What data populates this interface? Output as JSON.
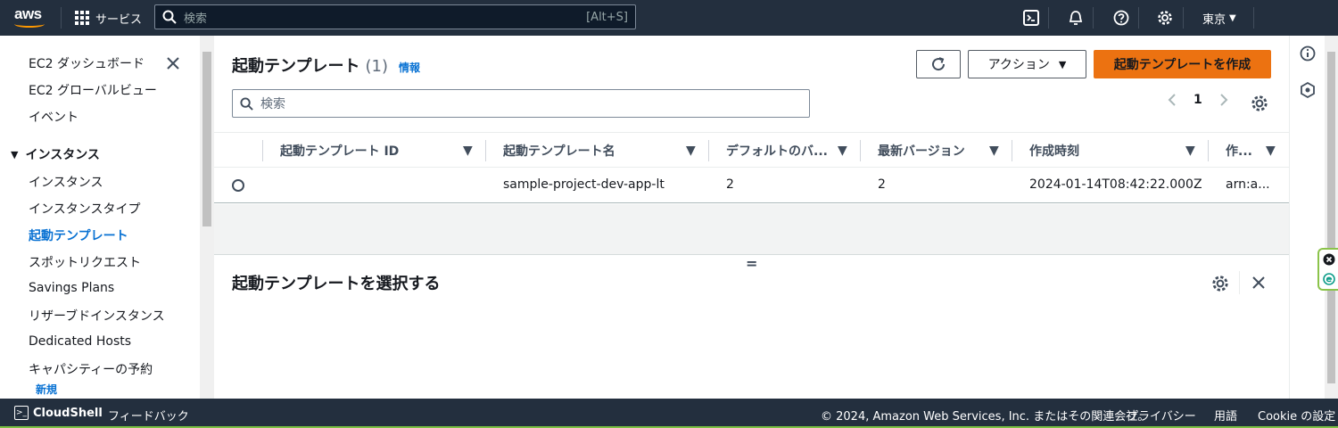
{
  "topnav": {
    "logo_text": "aws",
    "services_label": "サービス",
    "search_placeholder": "検索",
    "search_shortcut": "[Alt+S]",
    "region": "東京"
  },
  "sidebar": {
    "items": [
      {
        "label": "EC2 ダッシュボード"
      },
      {
        "label": "EC2 グローバルビュー"
      },
      {
        "label": "イベント"
      }
    ],
    "section_title": "インスタンス",
    "section_items": [
      {
        "label": "インスタンス"
      },
      {
        "label": "インスタンスタイプ"
      },
      {
        "label": "起動テンプレート",
        "active": true
      },
      {
        "label": "スポットリクエスト"
      },
      {
        "label": "Savings Plans"
      },
      {
        "label": "リザーブドインスタンス"
      },
      {
        "label": "Dedicated Hosts"
      },
      {
        "label": "キャパシティーの予約"
      }
    ],
    "new_badge": "新規"
  },
  "main": {
    "title": "起動テンプレート",
    "count": "(1)",
    "info_link": "情報",
    "actions_label": "アクション",
    "create_label": "起動テンプレートを作成",
    "search_placeholder": "検索",
    "page_number": "1",
    "columns": [
      "起動テンプレート ID",
      "起動テンプレート名",
      "デフォルトのバ...",
      "最新バージョン",
      "作成時刻",
      "作..."
    ],
    "rows": [
      {
        "id": "",
        "name": "sample-project-dev-app-lt",
        "default_version": "2",
        "latest_version": "2",
        "created": "2024-01-14T08:42:22.000Z",
        "owner": "arn:a..."
      }
    ],
    "split_handle": "=",
    "split_title": "起動テンプレートを選択する"
  },
  "footer": {
    "cloudshell": "CloudShell",
    "feedback": "フィードバック",
    "copyright": "© 2024, Amazon Web Services, Inc. またはその関連会社。",
    "privacy": "プライバシー",
    "terms": "用語",
    "cookie": "Cookie の設定"
  },
  "colors": {
    "nav_bg": "#232f3e",
    "primary_button": "#ec7211",
    "link": "#0972d3"
  },
  "icons": [
    "search-icon",
    "grid-icon",
    "cloudshell-icon",
    "bell-icon",
    "help-icon",
    "gear-icon",
    "refresh-icon",
    "close-icon"
  ]
}
